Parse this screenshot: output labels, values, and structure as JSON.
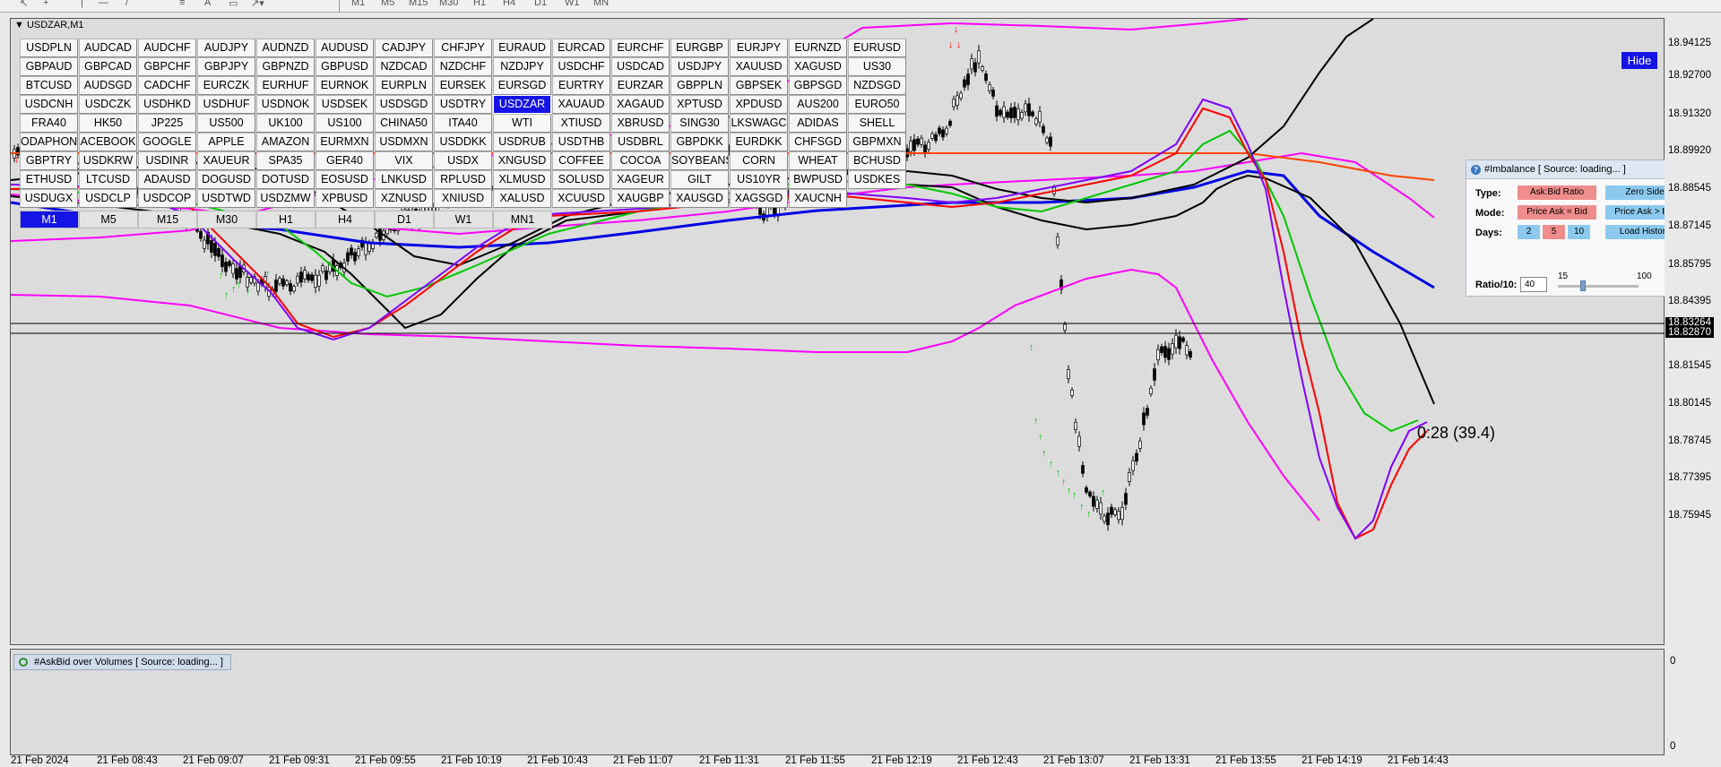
{
  "toolbar": {
    "timeframes": [
      "M1",
      "M5",
      "M15",
      "M30",
      "H1",
      "H4",
      "D1",
      "W1",
      "MN"
    ]
  },
  "window": {
    "title": "USDZAR,M1"
  },
  "symbols": [
    "USDPLN",
    "AUDCAD",
    "AUDCHF",
    "AUDJPY",
    "AUDNZD",
    "AUDUSD",
    "CADJPY",
    "CHFJPY",
    "EURAUD",
    "EURCAD",
    "EURCHF",
    "EURGBP",
    "EURJPY",
    "EURNZD",
    "EURUSD",
    "GBPAUD",
    "GBPCAD",
    "GBPCHF",
    "GBPJPY",
    "GBPNZD",
    "GBPUSD",
    "NZDCAD",
    "NZDCHF",
    "NZDJPY",
    "USDCHF",
    "USDCAD",
    "USDJPY",
    "XAUUSD",
    "XAGUSD",
    "US30",
    "BTCUSD",
    "AUDSGD",
    "CADCHF",
    "EURCZK",
    "EURHUF",
    "EURNOK",
    "EURPLN",
    "EURSEK",
    "EURSGD",
    "EURTRY",
    "EURZAR",
    "GBPPLN",
    "GBPSEK",
    "GBPSGD",
    "NZDSGD",
    "USDCNH",
    "USDCZK",
    "USDHKD",
    "USDHUF",
    "USDNOK",
    "USDSEK",
    "USDSGD",
    "USDTRY",
    "USDZAR",
    "XAUAUD",
    "XAGAUD",
    "XPTUSD",
    "XPDUSD",
    "AUS200",
    "EURO50",
    "FRA40",
    "HK50",
    "JP225",
    "US500",
    "UK100",
    "US100",
    "CHINA50",
    "ITA40",
    "WTI",
    "XTIUSD",
    "XBRUSD",
    "SING30",
    "LKSWAGC",
    "ADIDAS",
    "SHELL",
    "ODAPHON",
    "ACEBOOK",
    "GOOGLE",
    "APPLE",
    "AMAZON",
    "EURMXN",
    "USDMXN",
    "USDDKK",
    "USDRUB",
    "USDTHB",
    "USDBRL",
    "GBPDKK",
    "EURDKK",
    "CHFSGD",
    "GBPMXN",
    "GBPTRY",
    "USDKRW",
    "USDINR",
    "XAUEUR",
    "SPA35",
    "GER40",
    "VIX",
    "USDX",
    "XNGUSD",
    "COFFEE",
    "COCOA",
    "SOYBEANS",
    "CORN",
    "WHEAT",
    "BCHUSD",
    "ETHUSD",
    "LTCUSD",
    "ADAUSD",
    "DOGUSD",
    "DOTUSD",
    "EOSUSD",
    "LNKUSD",
    "RPLUSD",
    "XLMUSD",
    "SOLUSD",
    "XAGEUR",
    "GILT",
    "US10YR",
    "BWPUSD",
    "USDKES",
    "USDUGX",
    "USDCLP",
    "USDCOP",
    "USDTWD",
    "USDZMW",
    "XPBUSD",
    "XZNUSD",
    "XNIUSD",
    "XALUSD",
    "XCUUSD",
    "XAUGBP",
    "XAUSGD",
    "XAGSGD",
    "XAUCNH"
  ],
  "active_symbol": "USDZAR",
  "chart_timeframes": [
    "M1",
    "M5",
    "M15",
    "M30",
    "H1",
    "H4",
    "D1",
    "W1",
    "MN1"
  ],
  "active_timeframe": "M1",
  "hide_label": "Hide",
  "price_labels": [
    "18.94125",
    "18.92700",
    "18.91320",
    "18.89920",
    "18.88545",
    "18.87145",
    "18.85795",
    "18.84395",
    "18.83264",
    "18.82870",
    "18.81545",
    "18.80145",
    "18.78745",
    "18.77395",
    "18.75945"
  ],
  "current_prices": {
    "bid": "18.83264",
    "ask": "18.82870"
  },
  "countdown": "0:28 (39.4)",
  "time_labels": [
    "21 Feb 2024",
    "21 Feb 08:43",
    "21 Feb 09:07",
    "21 Feb 09:31",
    "21 Feb 09:55",
    "21 Feb 10:19",
    "21 Feb 10:43",
    "21 Feb 11:07",
    "21 Feb 11:31",
    "21 Feb 11:55",
    "21 Feb 12:19",
    "21 Feb 12:43",
    "21 Feb 13:07",
    "21 Feb 13:31",
    "21 Feb 13:55",
    "21 Feb 14:19",
    "21 Feb 14:43"
  ],
  "imbalance": {
    "title": "#Imbalance [ Source: loading... ]",
    "type_label": "Type:",
    "type_opt1": "Ask:Bid Ratio",
    "type_opt2": "Zero Side",
    "mode_label": "Mode:",
    "mode_opt1": "Price Ask = Bid",
    "mode_opt2": "Price Ask > Bid",
    "days_label": "Days:",
    "days": [
      "2",
      "5",
      "10"
    ],
    "load_label": "Load History",
    "ratio_label": "Ratio/10:",
    "ratio_value": "40",
    "ratio_min": "15",
    "ratio_max": "100"
  },
  "lower": {
    "title": "#AskBid over Volumes [ Source: loading... ]",
    "scale_top": "0",
    "scale_bottom": "0"
  },
  "colors": {
    "bg": "#dcdcdc",
    "active": "#1414e6",
    "magenta": "#ff00ff",
    "blue": "#0000e6",
    "red": "#ff0000",
    "green": "#00c800",
    "orange": "#ff4500",
    "purple": "#8000ff"
  }
}
